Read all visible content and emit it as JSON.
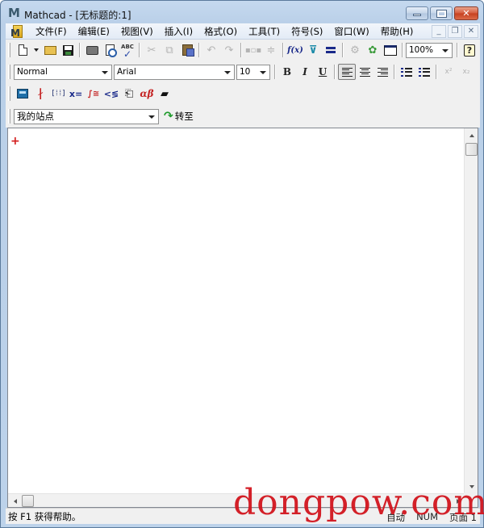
{
  "window": {
    "title": "Mathcad - [无标题的:1]",
    "controls": {
      "minimize": "minimize",
      "maximize": "maximize",
      "close": "close"
    }
  },
  "menubar": {
    "items": [
      {
        "label": "文件(F)"
      },
      {
        "label": "编辑(E)"
      },
      {
        "label": "视图(V)"
      },
      {
        "label": "插入(I)"
      },
      {
        "label": "格式(O)"
      },
      {
        "label": "工具(T)"
      },
      {
        "label": "符号(S)"
      },
      {
        "label": "窗口(W)"
      },
      {
        "label": "帮助(H)"
      }
    ],
    "mdi": {
      "minimize": "_",
      "restore": "❐",
      "close": "✕"
    }
  },
  "standard_toolbar": {
    "zoom_value": "100%",
    "help_glyph": "?",
    "fx_glyph": "f(x)",
    "spell_glyph": "ABC",
    "spell_check": "✓",
    "cut_glyph": "✂"
  },
  "formatting_toolbar": {
    "style_value": "Normal",
    "font_value": "Arial",
    "size_value": "10",
    "bold": "B",
    "italic": "I",
    "underline": "U",
    "superscript": "x²",
    "subscript": "x₂",
    "active_alignment": "left"
  },
  "math_toolbar": {
    "graph_glyph": "∤",
    "matrix_glyph": "[⁞⁞]",
    "evaluation_glyph": "x=",
    "calculus_glyph": "∫≅",
    "boolean_glyph": "<≶",
    "programming_glyph": "⎗",
    "greek_glyph": "αβ",
    "symbolic_glyph": "🎓"
  },
  "resources_toolbar": {
    "site_value": "我的站点",
    "goto_label": "转至",
    "goto_arrow": "↷"
  },
  "worksheet": {
    "cursor": "+"
  },
  "statusbar": {
    "message": "按 F1 获得帮助。",
    "mode": "自动",
    "num": "NUM",
    "page": "页面 1"
  },
  "watermark": "dongpow.com"
}
